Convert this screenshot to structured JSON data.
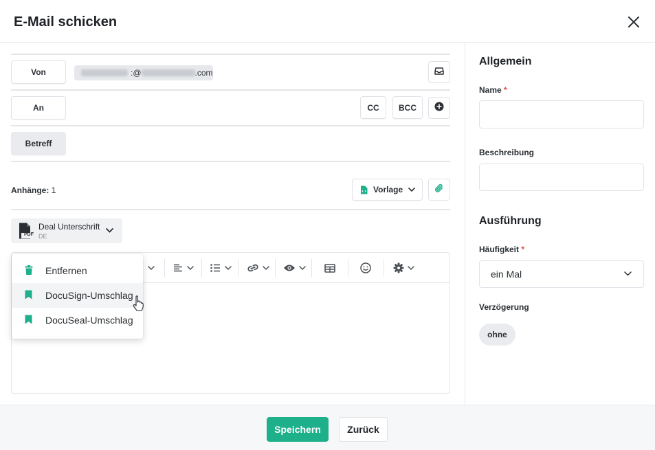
{
  "dialog": {
    "title": "E-Mail schicken"
  },
  "fields": {
    "from_label": "Von",
    "from_value_suffix": ":@",
    "from_domain": ".com",
    "to_label": "An",
    "cc_label": "CC",
    "bcc_label": "BCC",
    "subject_label": "Betreff"
  },
  "attachments": {
    "label": "Anhänge:",
    "count": "1",
    "template_label": "Vorlage"
  },
  "document": {
    "name": "Deal Unterschrift",
    "lang": "DE",
    "icon_text": "PDF"
  },
  "menu": {
    "items": [
      {
        "label": "Entfernen",
        "icon": "trash-icon"
      },
      {
        "label": "DocuSign-Umschlag",
        "icon": "bookmark-icon"
      },
      {
        "label": "DocuSeal-Umschlag",
        "icon": "bookmark-icon"
      }
    ],
    "hovered_index": 1
  },
  "sidebar": {
    "general_heading": "Allgemein",
    "name_label": "Name",
    "name_value": "",
    "description_label": "Beschreibung",
    "description_value": "",
    "execution_heading": "Ausführung",
    "frequency_label": "Häufigkeit",
    "frequency_value": "ein Mal",
    "delay_label": "Verzögerung",
    "delay_value": "ohne",
    "required_marker": "*"
  },
  "footer": {
    "save_label": "Speichern",
    "back_label": "Zurück"
  },
  "colors": {
    "accent": "#1db08a",
    "required": "#e0483c",
    "border": "#e3e5e8"
  }
}
